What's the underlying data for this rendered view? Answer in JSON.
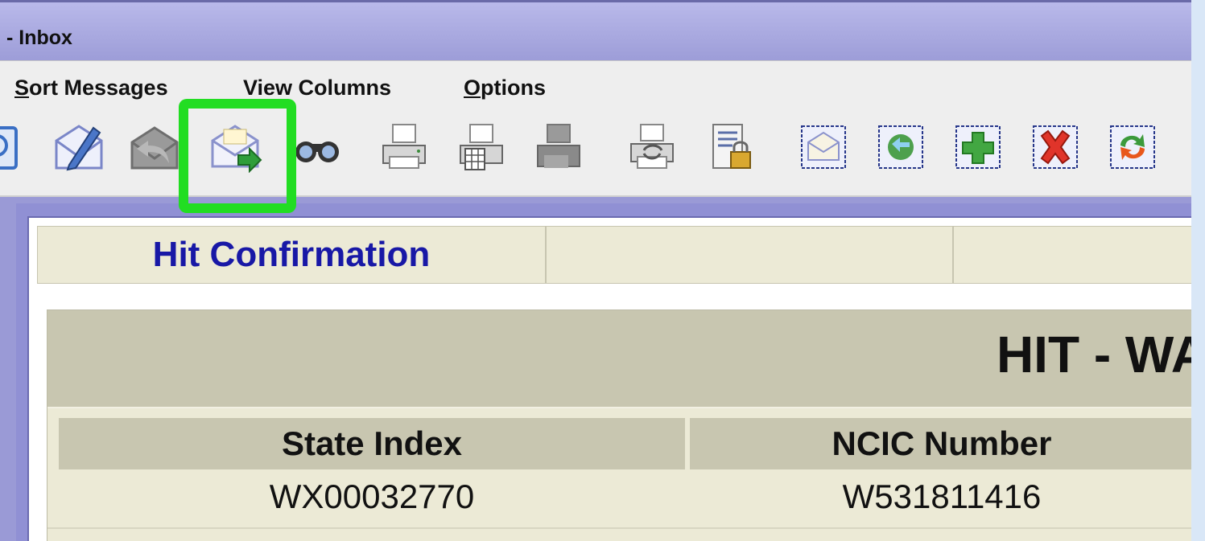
{
  "window": {
    "title": "- Inbox"
  },
  "menu": {
    "items": [
      {
        "mnemonic": "S",
        "rest": "ort Messages"
      },
      {
        "mnemonic": "",
        "rest": "View Columns"
      },
      {
        "mnemonic": "O",
        "rest": "ptions"
      }
    ]
  },
  "toolbar": {
    "buttons": [
      "search-message-icon",
      "compose-message-icon",
      "reply-message-icon",
      "forward-message-icon",
      "find-binoculars-icon",
      "print-icon",
      "print-table-icon",
      "print-disabled-icon",
      "print-refresh-icon",
      "document-lock-icon",
      "mailbox-envelope-icon",
      "mailbox-sync-icon",
      "mailbox-add-icon",
      "mailbox-delete-icon",
      "mailbox-refresh-icon"
    ],
    "highlighted": "forward-message-icon",
    "highlight_color": "#22dd22"
  },
  "message": {
    "tab_title": "Hit Confirmation",
    "banner": "HIT - WA",
    "columns": [
      {
        "header": "State Index",
        "value": "WX00032770"
      },
      {
        "header": "NCIC Number",
        "value": "W531811416"
      }
    ]
  },
  "colors": {
    "title_bar": "#a8a8df",
    "tab_title_text": "#1818a6",
    "panel_bg": "#ecead6",
    "panel_header_bg": "#c8c6b0"
  }
}
